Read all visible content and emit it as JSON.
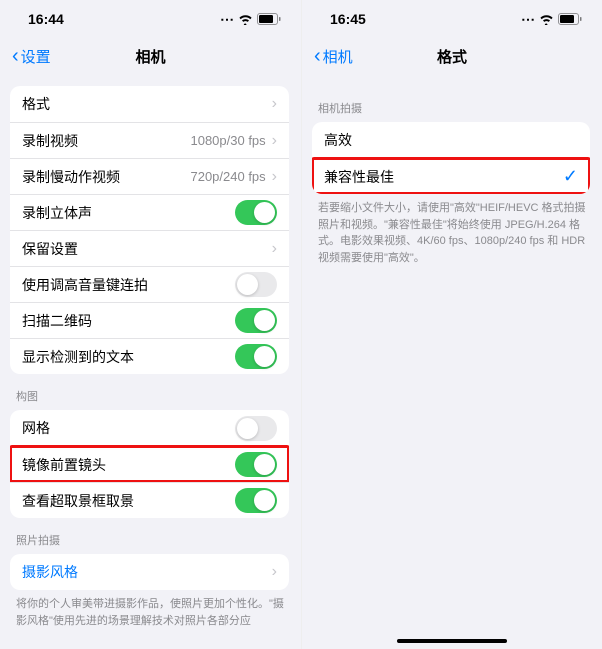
{
  "left": {
    "status_time": "16:44",
    "back_label": "设置",
    "title": "相机",
    "rows1": [
      {
        "label": "格式",
        "type": "chevron"
      },
      {
        "label": "录制视频",
        "value": "1080p/30 fps",
        "type": "chevron"
      },
      {
        "label": "录制慢动作视频",
        "value": "720p/240 fps",
        "type": "chevron"
      },
      {
        "label": "录制立体声",
        "type": "toggle",
        "on": true
      },
      {
        "label": "保留设置",
        "type": "chevron"
      },
      {
        "label": "使用调高音量键连拍",
        "type": "toggle",
        "on": false
      },
      {
        "label": "扫描二维码",
        "type": "toggle",
        "on": true
      },
      {
        "label": "显示检测到的文本",
        "type": "toggle",
        "on": true
      }
    ],
    "section2_header": "构图",
    "rows2": [
      {
        "label": "网格",
        "type": "toggle",
        "on": false
      },
      {
        "label": "镜像前置镜头",
        "type": "toggle",
        "on": true,
        "highlight": true
      },
      {
        "label": "查看超取景框取景",
        "type": "toggle",
        "on": true
      }
    ],
    "section3_header": "照片拍摄",
    "rows3": [
      {
        "label": "摄影风格",
        "type": "link"
      }
    ],
    "footer3": "将你的个人审美带进摄影作品，使照片更加个性化。\"摄影风格\"使用先进的场景理解技术对照片各部分应"
  },
  "right": {
    "status_time": "16:45",
    "back_label": "相机",
    "title": "格式",
    "section_header": "相机拍摄",
    "rows": [
      {
        "label": "高效"
      },
      {
        "label": "兼容性最佳",
        "checked": true,
        "highlight": true
      }
    ],
    "footer": "若要缩小文件大小，请使用\"高效\"HEIF/HEVC 格式拍摄照片和视频。\"兼容性最佳\"将始终使用 JPEG/H.264 格式。电影效果视频、4K/60 fps、1080p/240 fps 和 HDR 视频需要使用\"高效\"。"
  }
}
